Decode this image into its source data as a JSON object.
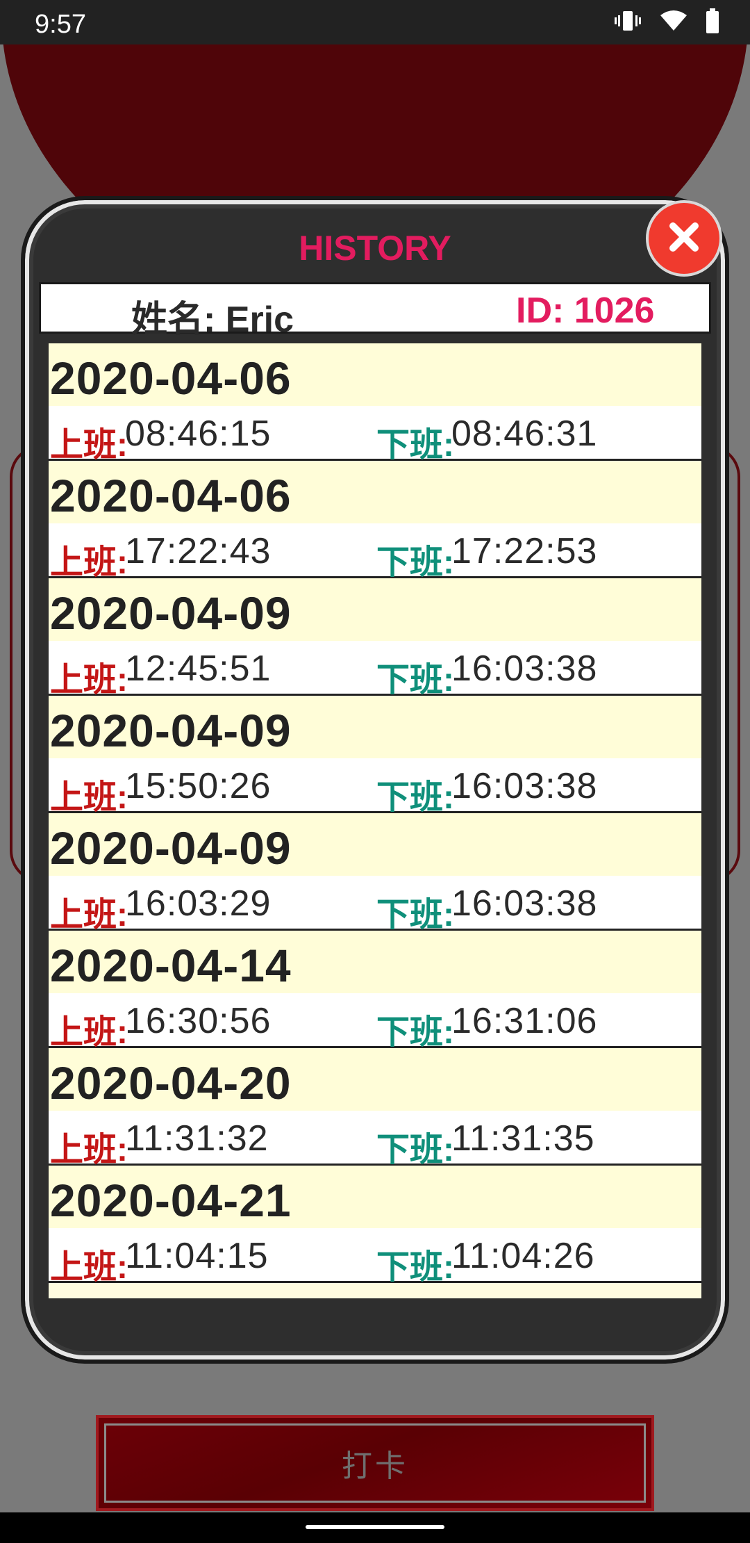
{
  "status_bar": {
    "time": "9:57",
    "icons": [
      "vibrate-icon",
      "wifi-icon",
      "battery-icon"
    ]
  },
  "background_app": {
    "clock_button_label": "打卡"
  },
  "dialog": {
    "title": "HISTORY",
    "name_line": "姓名: Eric",
    "id_line": "ID: 1026",
    "in_label": "上班:",
    "out_label": "下班:",
    "records": [
      {
        "date": "2020-04-06",
        "clock_in": "08:46:15",
        "clock_out": "08:46:31"
      },
      {
        "date": "2020-04-06",
        "clock_in": "17:22:43",
        "clock_out": "17:22:53"
      },
      {
        "date": "2020-04-09",
        "clock_in": "12:45:51",
        "clock_out": "16:03:38"
      },
      {
        "date": "2020-04-09",
        "clock_in": "15:50:26",
        "clock_out": "16:03:38"
      },
      {
        "date": "2020-04-09",
        "clock_in": "16:03:29",
        "clock_out": "16:03:38"
      },
      {
        "date": "2020-04-14",
        "clock_in": "16:30:56",
        "clock_out": "16:31:06"
      },
      {
        "date": "2020-04-20",
        "clock_in": "11:31:32",
        "clock_out": "11:31:35"
      },
      {
        "date": "2020-04-21",
        "clock_in": "11:04:15",
        "clock_out": "11:04:26"
      }
    ]
  },
  "colors": {
    "accent_pink": "#e31c5f",
    "clock_in_red": "#c41616",
    "clock_out_teal": "#0f8f7a",
    "row_date_bg": "#fffdd8",
    "close_red": "#f03a2e",
    "bg_dark_red": "#4f0509"
  }
}
